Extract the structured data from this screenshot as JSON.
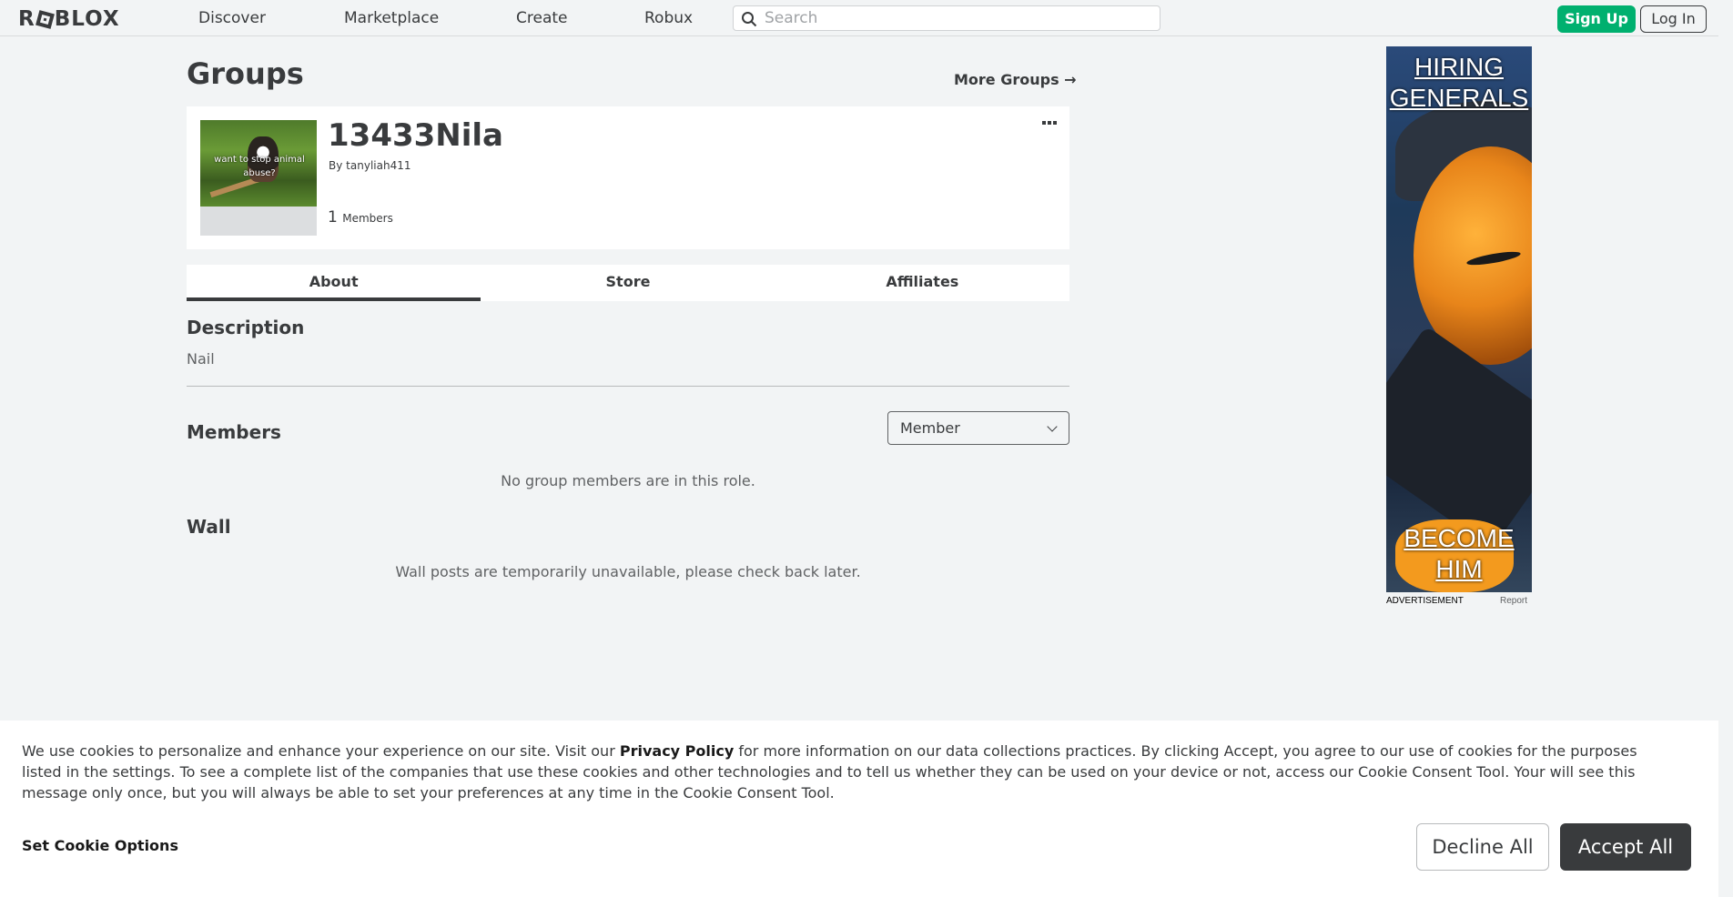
{
  "header": {
    "logo": "ROBLOX",
    "nav": [
      "Discover",
      "Marketplace",
      "Create",
      "Robux"
    ],
    "search_placeholder": "Search",
    "signup_label": "Sign Up",
    "login_label": "Log In"
  },
  "page": {
    "title": "Groups",
    "more_groups": "More Groups →"
  },
  "group": {
    "name": "13433Nila",
    "by_label": "By",
    "owner": "tanyliah411",
    "member_count": "1",
    "members_label": "Members",
    "thumbnail_caption": "want to stop animal abuse?"
  },
  "tabs": [
    {
      "label": "About",
      "active": true
    },
    {
      "label": "Store",
      "active": false
    },
    {
      "label": "Affiliates",
      "active": false
    }
  ],
  "about": {
    "description_title": "Description",
    "description_text": "Nail",
    "members_title": "Members",
    "role_selected": "Member",
    "members_empty": "No group members are in this role.",
    "wall_title": "Wall",
    "wall_empty": "Wall posts are temporarily unavailable, please check back later."
  },
  "ad": {
    "top_text": "HIRING GENERALS",
    "bottom_text": "BECOME HIM",
    "label": "ADVERTISEMENT",
    "report": "Report"
  },
  "cookie": {
    "text_before": "We use cookies to personalize and enhance your experience on our site. Visit our ",
    "privacy_link": "Privacy Policy",
    "text_after": " for more information on our data collections practices. By clicking Accept, you agree to our use of cookies for the purposes listed in the settings. To see a complete list of the companies that use these cookies and other technologies and to tell us whether they can be used on your device or not, access our Cookie Consent Tool. Your will see this message only once, but you will always be able to set your preferences at any time in the Cookie Consent Tool.",
    "options_label": "Set Cookie Options",
    "decline_label": "Decline All",
    "accept_label": "Accept All"
  },
  "colors": {
    "accent_green": "#00b06f",
    "text_dark": "#393b3d",
    "background": "#f2f4f5"
  }
}
